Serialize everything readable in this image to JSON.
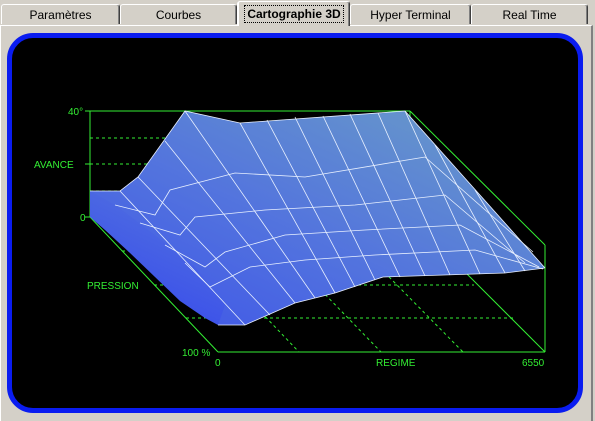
{
  "tabs": [
    {
      "label": "Paramètres",
      "active": false
    },
    {
      "label": "Courbes",
      "active": false
    },
    {
      "label": "Cartographie 3D",
      "active": true
    },
    {
      "label": "Hyper Terminal",
      "active": false
    },
    {
      "label": "Real Time",
      "active": false
    }
  ],
  "plot": {
    "z_axis_label": "AVANCE",
    "z_max_label": "40°",
    "z_zero_label": "0",
    "y_axis_label": "PRESSION",
    "y_max_label": "100 %",
    "x_axis_label": "REGIME",
    "x_min_label": "0",
    "x_max_label": "6550"
  },
  "colors": {
    "frame_border": "#0a1cf0",
    "grid_green": "#33ee33",
    "surface_low": "#3a4ae6",
    "surface_high": "#73b5b5"
  }
}
